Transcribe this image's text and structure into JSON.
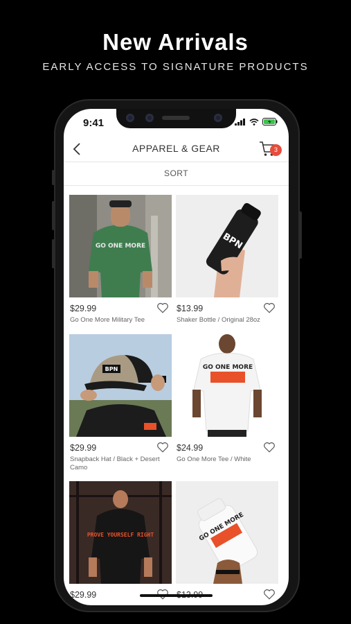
{
  "promo": {
    "headline": "New Arrivals",
    "subline": "EARLY ACCESS TO SIGNATURE PRODUCTS"
  },
  "status_bar": {
    "time": "9:41"
  },
  "nav": {
    "title": "APPAREL & GEAR",
    "cart_count": "3"
  },
  "sort_label": "SORT",
  "products": [
    {
      "price": "$29.99",
      "name": "Go One More Military Tee"
    },
    {
      "price": "$13.99",
      "name": "Shaker Bottle / Original 28oz"
    },
    {
      "price": "$29.99",
      "name": "Snapback Hat / Black + Desert Camo"
    },
    {
      "price": "$24.99",
      "name": "Go One More Tee / White"
    },
    {
      "price": "$29.99",
      "name": ""
    },
    {
      "price": "$13.99",
      "name": ""
    }
  ],
  "image_text": {
    "tee_print": "GO ONE MORE",
    "bottle_logo": "BPN",
    "white_tee_print": "GO ONE MORE",
    "back_print": "PROVE YOURSELF RIGHT"
  },
  "colors": {
    "badge": "#e74c3c",
    "accent_orange": "#e8512a",
    "military_green": "#3f7d4f"
  }
}
